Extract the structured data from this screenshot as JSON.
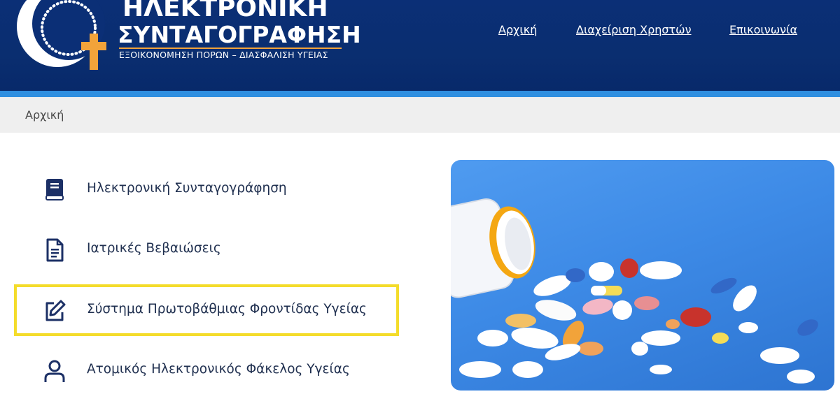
{
  "header": {
    "logo_title_line1": "ΗΛΕΚΤΡΟΝΙΚΗ",
    "logo_title_line2": "ΣΥΝΤΑΓΟΓΡΑΦΗΣΗ",
    "logo_subtitle": "ΕΞΟΙΚΟΝΟΜΗΣΗ ΠΟΡΩΝ – ΔΙΑΣΦΑΛΙΣΗ ΥΓΕΙΑΣ",
    "nav": [
      {
        "label": "Αρχική"
      },
      {
        "label": "Διαχείριση Χρηστών"
      },
      {
        "label": "Επικοινωνία"
      }
    ]
  },
  "breadcrumb": {
    "current": "Αρχική"
  },
  "menu": [
    {
      "label": "Ηλεκτρονική Συνταγογράφηση",
      "icon": "book-icon"
    },
    {
      "label": "Ιατρικές Βεβαιώσεις",
      "icon": "document-icon"
    },
    {
      "label": "Σύστημα Πρωτοβάθμιας Φροντίδας Υγείας",
      "icon": "edit-icon",
      "highlighted": true
    },
    {
      "label": "Ατομικός Ηλεκτρονικός Φάκελος Υγείας",
      "icon": "user-icon"
    }
  ],
  "colors": {
    "header_bg": "#0b2f76",
    "header_stripe": "#2f8fe0",
    "logo_accent": "#f2a33a",
    "highlight_border": "#f4dc2b",
    "icon_color": "#1c3066",
    "photo_bg": "#3d8ae6"
  }
}
